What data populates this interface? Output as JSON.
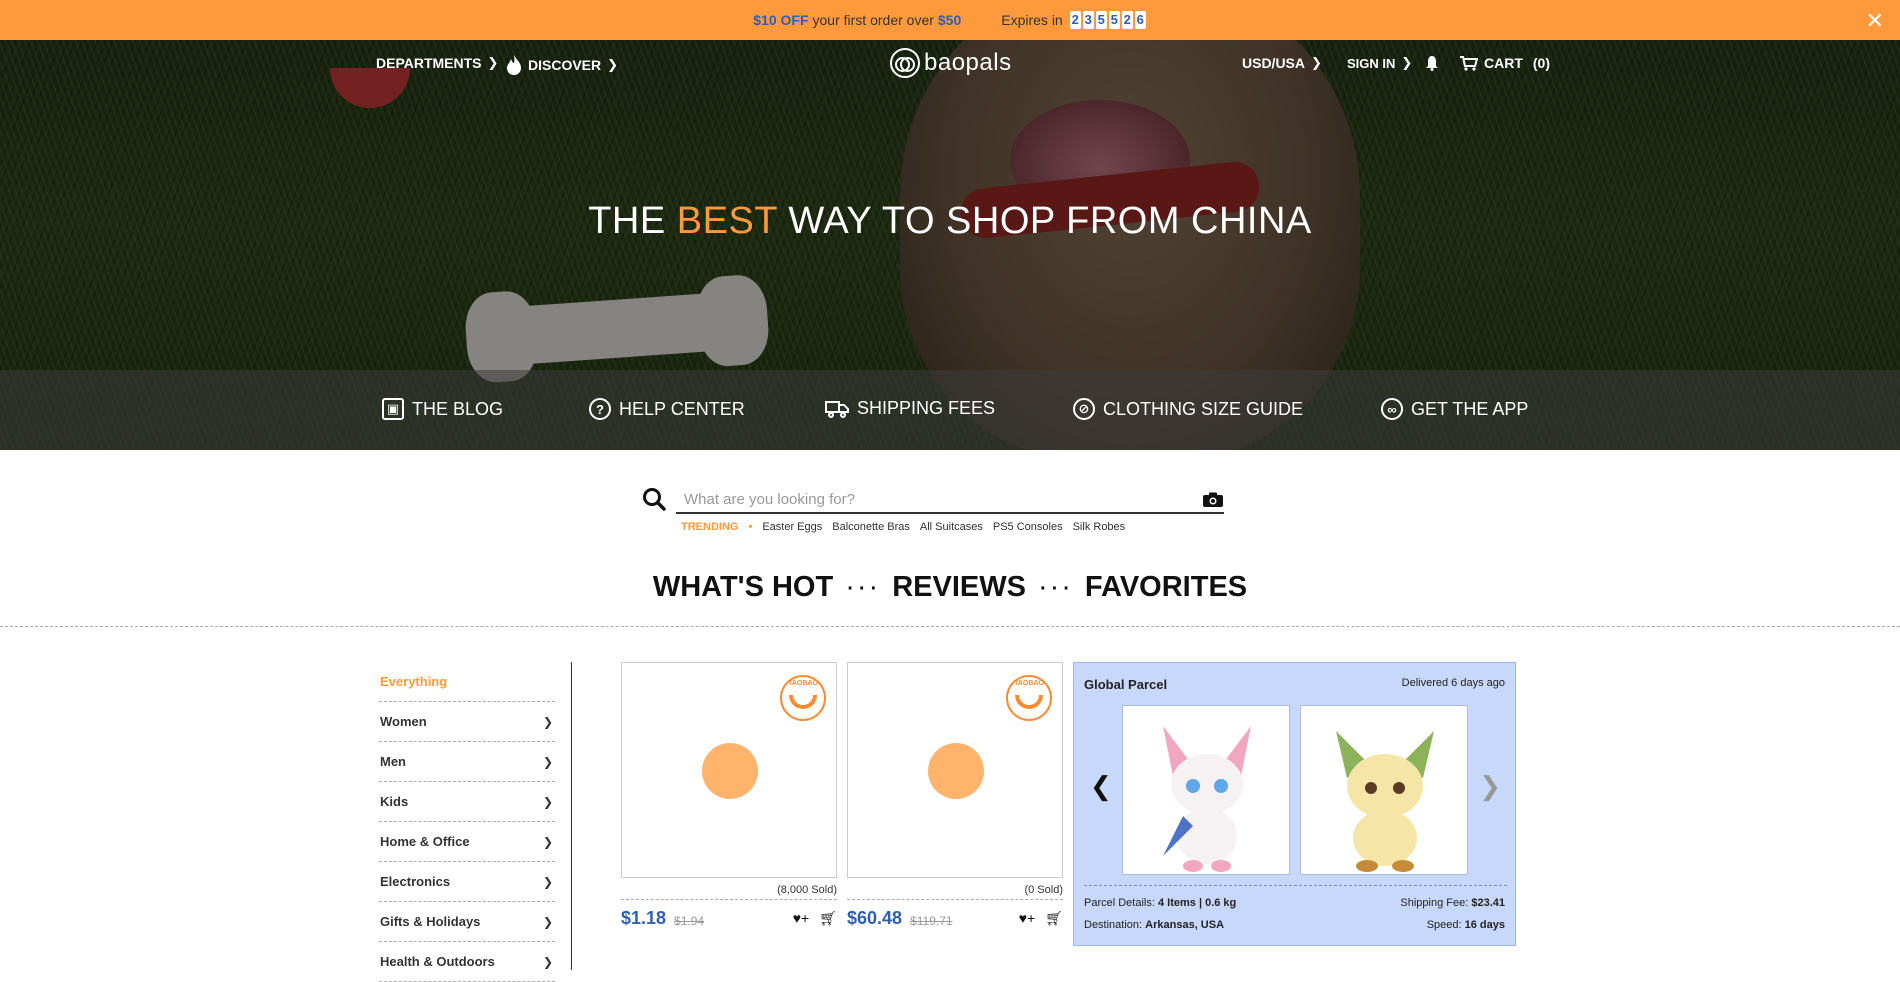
{
  "promo": {
    "amount": "$10 OFF",
    "text": "your first order over",
    "minimum": "$50",
    "expires_label": "Expires in",
    "digits": [
      "2",
      "3",
      "5",
      "5",
      "2",
      "6"
    ]
  },
  "nav": {
    "departments": "DEPARTMENTS",
    "discover": "DISCOVER",
    "logo": "baopals",
    "currency": "USD/USA",
    "signin": "SIGN IN",
    "cart": "CART",
    "cart_count": "(0)"
  },
  "hero": {
    "headline_pre": "THE",
    "headline_accent": "BEST",
    "headline_post": "WAY TO SHOP FROM CHINA",
    "links": [
      {
        "label": "THE BLOG",
        "icon": "image-icon"
      },
      {
        "label": "HELP CENTER",
        "icon": "question-icon"
      },
      {
        "label": "SHIPPING FEES",
        "icon": "truck-icon"
      },
      {
        "label": "CLOTHING SIZE GUIDE",
        "icon": "no-shirt-icon"
      },
      {
        "label": "GET THE APP",
        "icon": "baopals-icon"
      }
    ]
  },
  "search": {
    "placeholder": "What are you looking for?",
    "trending_label": "TRENDING",
    "trending": [
      "Easter Eggs",
      "Balconette Bras",
      "All Suitcases",
      "PS5 Consoles",
      "Silk Robes"
    ]
  },
  "tabs": [
    "WHAT'S HOT",
    "REVIEWS",
    "FAVORITES"
  ],
  "sidebar": {
    "items": [
      "Everything",
      "Women",
      "Men",
      "Kids",
      "Home & Office",
      "Electronics",
      "Gifts & Holidays",
      "Health & Outdoors"
    ]
  },
  "products": [
    {
      "sold": "(8,000 Sold)",
      "price": "$1.18",
      "old_price": "$1.94"
    },
    {
      "sold": "(0 Sold)",
      "price": "$60.48",
      "old_price": "$119.71"
    }
  ],
  "parcel": {
    "title": "Global Parcel",
    "delivered": "Delivered 6 days ago",
    "details_label": "Parcel Details:",
    "details_value": "4 Items | 0.6 kg",
    "destination_label": "Destination:",
    "destination_value": "Arkansas, USA",
    "fee_label": "Shipping Fee:",
    "fee_value": "$23.41",
    "speed_label": "Speed:",
    "speed_value": "16 days"
  },
  "colors": {
    "accent": "#ff9a3c",
    "price": "#2d5fb8",
    "parcel_bg": "#c8d8fb"
  }
}
